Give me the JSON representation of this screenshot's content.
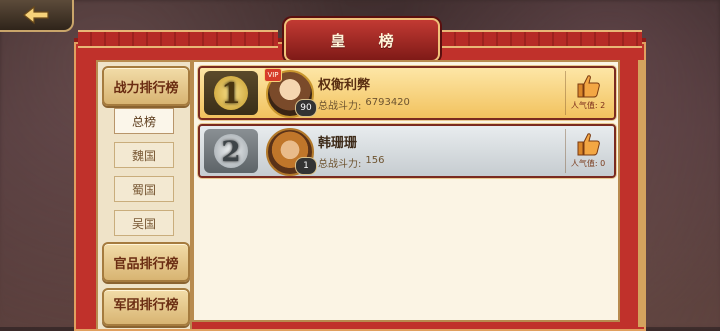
{
  "header": {
    "title": "皇 榜",
    "back_label": "back"
  },
  "sidebar": {
    "combat_tab": "战力排行榜",
    "sub_tabs": [
      "总榜",
      "魏国",
      "蜀国",
      "吴国"
    ],
    "active_sub_tab": "总榜",
    "official_tab": "官品排行榜",
    "legion_tab": "军团排行榜"
  },
  "rankings": [
    {
      "rank": "1",
      "name": "权衡利弊",
      "power_label": "总战斗力:",
      "power_value": "6793420",
      "level": "90",
      "popularity_label": "人气值:",
      "popularity_value": "2",
      "vip": "VIP"
    },
    {
      "rank": "2",
      "name": "韩珊珊",
      "power_label": "总战斗力:",
      "power_value": "156",
      "level": "1",
      "popularity_label": "人气值:",
      "popularity_value": "0"
    }
  ],
  "colors": {
    "frame_red": "#c0312b",
    "gold_row": "#f2c25e",
    "silver_row": "#c6ccd0"
  },
  "icons": {
    "back": "arrow-left-icon",
    "like": "thumbs-up-icon"
  }
}
